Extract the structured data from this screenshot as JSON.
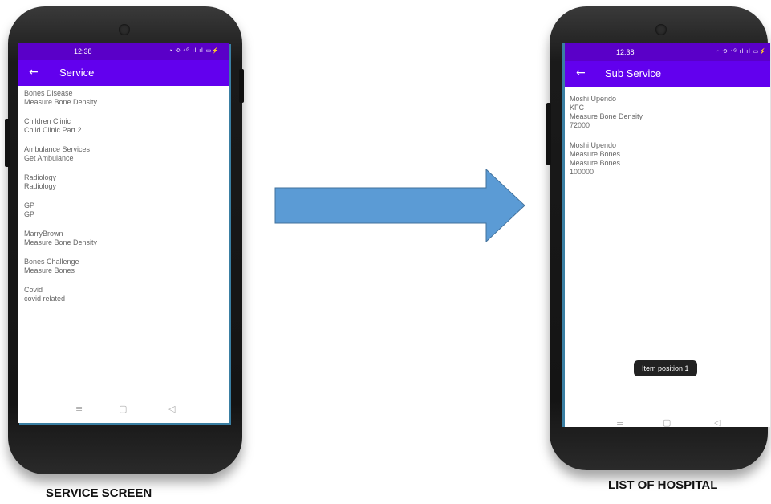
{
  "left_phone": {
    "status_time": "12:38",
    "status_icons": "◔ ⟲ ⁴ᴳ ıl ıl ▭⚡",
    "back_icon": "←",
    "title": "Service",
    "items": [
      {
        "line1": "Bones Disease",
        "line2": "Measure Bone Density"
      },
      {
        "line1": "Children Clinic",
        "line2": "Child Clinic Part 2"
      },
      {
        "line1": "Ambulance Services",
        "line2": "Get Ambulance"
      },
      {
        "line1": "Radiology",
        "line2": "Radiology"
      },
      {
        "line1": "GP",
        "line2": "GP"
      },
      {
        "line1": "MarryBrown",
        "line2": "Measure Bone Density"
      },
      {
        "line1": "Bones Challenge",
        "line2": "Measure Bones"
      },
      {
        "line1": "Covid",
        "line2": "covid related"
      }
    ],
    "nav": {
      "menu": "≡",
      "home": "▢",
      "back": "◁"
    }
  },
  "right_phone": {
    "status_time": "12:38",
    "status_icons": "◔ ⟲ ⁴ᴳ ıl ıl ▭⚡",
    "back_icon": "←",
    "title": "Sub Service",
    "items": [
      {
        "lines": [
          "Moshi Upendo",
          "KFC",
          "Measure Bone Density",
          "72000"
        ]
      },
      {
        "lines": [
          "Moshi Upendo",
          "Measure Bones",
          "Measure Bones",
          "100000"
        ]
      }
    ],
    "toast": "Item position 1",
    "nav": {
      "menu": "≡",
      "home": "▢",
      "back": "◁"
    }
  },
  "captions": {
    "left": "SERVICE SCREEN",
    "right": "LIST OF HOSPITAL"
  },
  "colors": {
    "status_bar": "#5a00c8",
    "app_bar": "#6200ee",
    "arrow": "#5b9bd5",
    "arrow_border": "#41719c"
  }
}
